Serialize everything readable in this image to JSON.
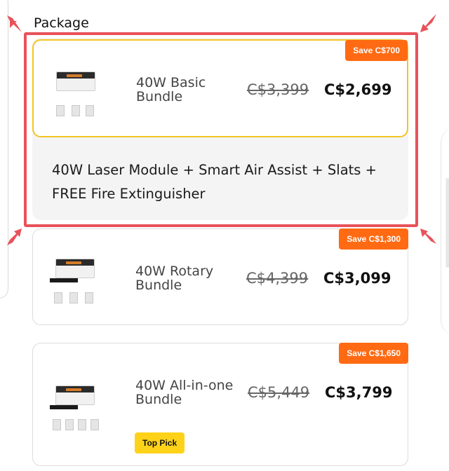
{
  "section": {
    "title": "Package"
  },
  "packages": [
    {
      "name": "40W Basic Bundle",
      "badge": "Save C$700",
      "old_price": "C$3,399",
      "price": "C$2,699",
      "selected": true,
      "details": "40W Laser Module + Smart Air Assist + Slats + FREE Fire Extinguisher"
    },
    {
      "name": "40W Rotary Bundle",
      "badge": "Save C$1,300",
      "old_price": "C$4,399",
      "price": "C$3,099",
      "selected": false
    },
    {
      "name": "40W All-in-one Bundle",
      "badge": "Save C$1,650",
      "old_price": "C$5,449",
      "price": "C$3,799",
      "selected": false,
      "tag": "Top Pick"
    }
  ],
  "colors": {
    "highlight": "#e8525a",
    "badge": "#ff6a13",
    "selected_border": "#f2c522",
    "top_pick": "#ffd21a"
  },
  "icons": [
    "arrow-pointer-icon"
  ]
}
